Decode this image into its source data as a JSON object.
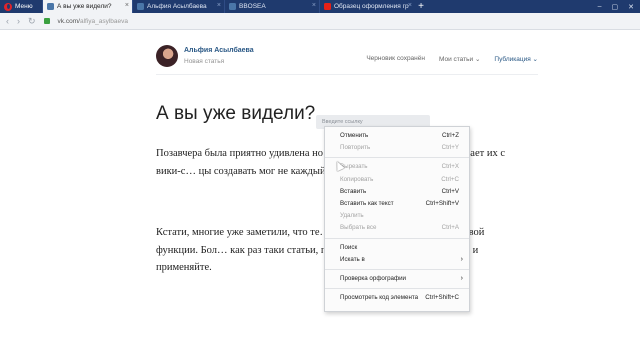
{
  "browser": {
    "menu_label": "Меню",
    "tabs": [
      {
        "title": "А вы уже видели?",
        "icon_color": "#4a76a8",
        "active": true
      },
      {
        "title": "Альфия Асылбаева",
        "icon_color": "#4a76a8",
        "active": false
      },
      {
        "title": "BBOSEA",
        "icon_color": "#4a76a8",
        "active": false
      },
      {
        "title": "Образец оформления гр",
        "icon_color": "#e62117",
        "active": false
      }
    ],
    "new_tab": "+",
    "url_host": "vk.com/",
    "url_path": "alfiya_asylbaeva"
  },
  "editor": {
    "author_name": "Альфия Асылбаева",
    "subtitle": "Новая статья",
    "draft_status": "Черновик сохранён",
    "my_articles": "Мои статьи",
    "publish": "Публикация",
    "article_title": "А вы уже видели?",
    "paragraph1": "Позавчера была приятно удивлена но… писать статьи. Кто-то сравнивает их с вики-с… цы создавать мог не каждый пользовате… любой.",
    "paragraph2": "Кстати, многие уже заметили, что те… отров. Все это как раз из-за новой функции. Бол… как раз таки статьи, поэтому если вы еще не … видео и применяйте.",
    "tooltip_text": "Введите ссылку"
  },
  "context_menu": {
    "items": [
      {
        "label": "Отменить",
        "shortcut": "Ctrl+Z",
        "disabled": false
      },
      {
        "label": "Повторить",
        "shortcut": "Ctrl+Y",
        "disabled": true
      },
      {
        "sep": true
      },
      {
        "label": "Вырезать",
        "shortcut": "Ctrl+X",
        "disabled": true
      },
      {
        "label": "Копировать",
        "shortcut": "Ctrl+C",
        "disabled": true
      },
      {
        "label": "Вставить",
        "shortcut": "Ctrl+V",
        "disabled": false
      },
      {
        "label": "Вставить как текст",
        "shortcut": "Ctrl+Shift+V",
        "disabled": false
      },
      {
        "label": "Удалить",
        "shortcut": "",
        "disabled": true
      },
      {
        "label": "Выбрать все",
        "shortcut": "Ctrl+A",
        "disabled": true
      },
      {
        "sep": true
      },
      {
        "label": "Поиск",
        "shortcut": "",
        "disabled": false
      },
      {
        "label": "Искать в",
        "shortcut": "",
        "submenu": true,
        "disabled": false
      },
      {
        "sep": true
      },
      {
        "label": "Проверка орфографии",
        "shortcut": "",
        "submenu": true,
        "disabled": false
      },
      {
        "sep": true
      },
      {
        "label": "Просмотреть код элемента",
        "shortcut": "Ctrl+Shift+C",
        "disabled": false
      }
    ]
  }
}
